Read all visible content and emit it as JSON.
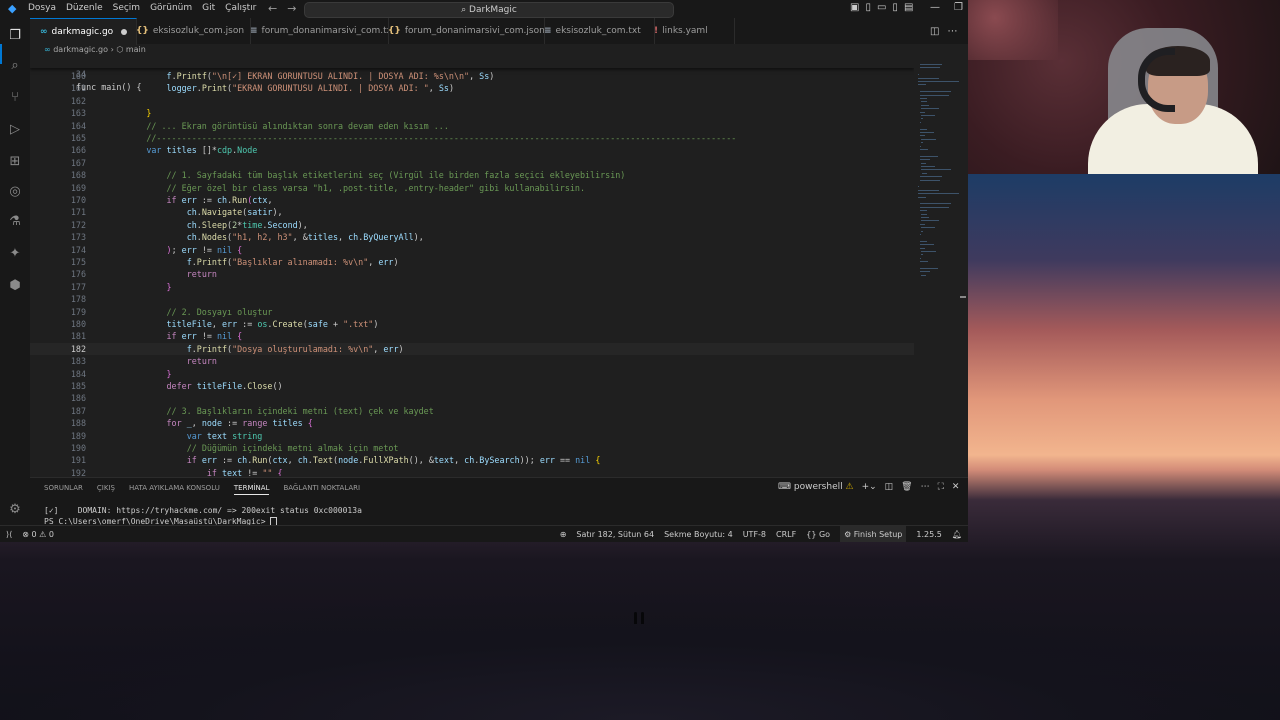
{
  "window": {
    "menu": [
      "Dosya",
      "Düzenle",
      "Seçim",
      "Görünüm",
      "Git",
      "Çalıştır"
    ],
    "search_text": "DarkMagic"
  },
  "tabs": [
    {
      "label": "darkmagic.go",
      "icon": "go-file-icon",
      "active": true,
      "modified": true
    },
    {
      "label": "eksisozluk_com.json",
      "icon": "json-file-icon"
    },
    {
      "label": "forum_donanimarsivi_com.txt",
      "icon": "text-file-icon"
    },
    {
      "label": "forum_donanimarsivi_com.json",
      "icon": "json-file-icon"
    },
    {
      "label": "eksisozluk_com.txt",
      "icon": "text-file-icon"
    },
    {
      "label": "links.yaml",
      "icon": "yaml-file-icon"
    }
  ],
  "breadcrumb": {
    "file": "darkmagic.go",
    "symbol": "main"
  },
  "editor": {
    "sticky_line": {
      "num": "34",
      "text": "func main() {"
    },
    "current_line": "182",
    "lines": [
      {
        "num": "160",
        "html": "            <span class=\"vr\">f</span>.<span class=\"fn\">Printf</span>(<span class=\"str\">\"\\n[✓] EKRAN GORUNTUSU ALINDI. | DOSYA ADI: %s\\n\\n\"</span>, <span class=\"vr\">Ss</span>)"
      },
      {
        "num": "161",
        "html": "            <span class=\"vr\">logger</span>.<span class=\"fn\">Print</span>(<span class=\"str\">\"EKRAN GORUNTUSU ALINDI. | DOSYA ADI: \"</span>, <span class=\"vr\">Ss</span>)"
      },
      {
        "num": "162",
        "html": ""
      },
      {
        "num": "163",
        "html": "        <span class=\"br\">}</span>"
      },
      {
        "num": "164",
        "html": "        <span class=\"cm\">// ... Ekran görüntüsü alındıktan sonra devam eden kısım ...</span>"
      },
      {
        "num": "165",
        "html": "        <span class=\"cm\">//-------------------------------------------------------------------------------------------------------------------</span>"
      },
      {
        "num": "166",
        "html": "        <span class=\"kw\">var</span> <span class=\"vr\">titles</span> []*<span class=\"ty\">cdp</span>.<span class=\"ty\">Node</span>"
      },
      {
        "num": "167",
        "html": ""
      },
      {
        "num": "168",
        "html": "            <span class=\"cm\">// 1. Sayfadaki tüm başlık etiketlerini seç (Virgül ile birden fazla seçici ekleyebilirsin)</span>"
      },
      {
        "num": "169",
        "html": "            <span class=\"cm\">// Eğer özel bir class varsa \"h1, .post-title, .entry-header\" gibi kullanabilirsin.</span>"
      },
      {
        "num": "170",
        "html": "            <span class=\"ctl\">if</span> <span class=\"vr\">err</span> := <span class=\"vr\">ch</span>.<span class=\"fn\">Run</span><span class=\"br2\">(</span><span class=\"vr\">ctx</span>,"
      },
      {
        "num": "171",
        "html": "                <span class=\"vr\">ch</span>.<span class=\"fn\">Navigate</span>(<span class=\"vr\">satir</span>),"
      },
      {
        "num": "172",
        "html": "                <span class=\"vr\">ch</span>.<span class=\"fn\">Sleep</span>(<span class=\"nm\">2</span>*<span class=\"ty\">time</span>.<span class=\"vr\">Second</span>),"
      },
      {
        "num": "173",
        "html": "                <span class=\"vr\">ch</span>.<span class=\"fn\">Nodes</span>(<span class=\"str\">\"h1, h2, h3\"</span>, &amp;<span class=\"vr\">titles</span>, <span class=\"vr\">ch</span>.<span class=\"vr\">ByQueryAll</span>),"
      },
      {
        "num": "174",
        "html": "            <span class=\"br2\">)</span>; <span class=\"vr\">err</span> != <span class=\"kw\">nil</span> <span class=\"br2\">{</span>"
      },
      {
        "num": "175",
        "html": "                <span class=\"vr\">f</span>.<span class=\"fn\">Printf</span>(<span class=\"str\">\"Başlıklar alınamadı: %v\\n\"</span>, <span class=\"vr\">err</span>)"
      },
      {
        "num": "176",
        "html": "                <span class=\"ctl\">return</span>"
      },
      {
        "num": "177",
        "html": "            <span class=\"br2\">}</span>"
      },
      {
        "num": "178",
        "html": ""
      },
      {
        "num": "179",
        "html": "            <span class=\"cm\">// 2. Dosyayı oluştur</span>"
      },
      {
        "num": "180",
        "html": "            <span class=\"vr\">titleFile</span>, <span class=\"vr\">err</span> := <span class=\"ty\">os</span>.<span class=\"fn\">Create</span>(<span class=\"vr\">safe</span> + <span class=\"str\">\".txt\"</span>)"
      },
      {
        "num": "181",
        "html": "            <span class=\"ctl\">if</span> <span class=\"vr\">err</span> != <span class=\"kw\">nil</span> <span class=\"br2\">{</span>"
      },
      {
        "num": "182",
        "html": "                <span class=\"vr\">f</span>.<span class=\"fn\">Printf</span>(<span class=\"str\">\"Dosya oluşturulamadı: %v\\n\"</span>, <span class=\"vr\">err</span>)"
      },
      {
        "num": "183",
        "html": "                <span class=\"ctl\">return</span>"
      },
      {
        "num": "184",
        "html": "            <span class=\"br2\">}</span>"
      },
      {
        "num": "185",
        "html": "            <span class=\"ctl\">defer</span> <span class=\"vr\">titleFile</span>.<span class=\"fn\">Close</span>()"
      },
      {
        "num": "186",
        "html": ""
      },
      {
        "num": "187",
        "html": "            <span class=\"cm\">// 3. Başlıkların içindeki metni (text) çek ve kaydet</span>"
      },
      {
        "num": "188",
        "html": "            <span class=\"ctl\">for</span> <span class=\"vr\">_</span>, <span class=\"vr\">node</span> := <span class=\"ctl\">range</span> <span class=\"vr\">titles</span> <span class=\"br2\">{</span>"
      },
      {
        "num": "189",
        "html": "                <span class=\"kw\">var</span> <span class=\"vr\">text</span> <span class=\"ty\">string</span>"
      },
      {
        "num": "190",
        "html": "                <span class=\"cm\">// Düğümün içindeki metni almak için metot</span>"
      },
      {
        "num": "191",
        "html": "                <span class=\"ctl\">if</span> <span class=\"vr\">err</span> := <span class=\"vr\">ch</span>.<span class=\"fn\">Run</span>(<span class=\"vr\">ctx</span>, <span class=\"vr\">ch</span>.<span class=\"fn\">Text</span>(<span class=\"vr\">node</span>.<span class=\"fn\">FullXPath</span>(), &amp;<span class=\"vr\">text</span>, <span class=\"vr\">ch</span>.<span class=\"vr\">BySearch</span>)); <span class=\"vr\">err</span> == <span class=\"kw\">nil</span> <span class=\"br\">{</span>"
      },
      {
        "num": "192",
        "html": "                    <span class=\"ctl\">if</span> <span class=\"vr\">text</span> != <span class=\"str\">\"\"</span> <span class=\"br2\">{</span>"
      }
    ]
  },
  "panel": {
    "tabs": [
      "SORUNLAR",
      "ÇIKIŞ",
      "HATA AYIKLAMA KONSOLU",
      "TERMİNAL",
      "BAĞLANTI NOKTALARI"
    ],
    "active_tab": "TERMİNAL",
    "shell_label": "powershell",
    "terminal_lines": [
      "[✓]    DOMAIN: https://tryhackme.com/ => 200exit status 0xc000013a",
      "PS C:\\Users\\omerf\\OneDrive\\Masaüstü\\DarkMagic> "
    ]
  },
  "statusbar": {
    "errors": "0",
    "warnings": "0",
    "position": "Satır 182, Sütun 64",
    "indent": "Sekme Boyutu: 4",
    "encoding": "UTF-8",
    "eol": "CRLF",
    "language": "Go",
    "setup": "Finish Setup",
    "version": "1.25.5"
  },
  "colors": {
    "accent": "#0078d4",
    "editor_bg": "#1f1f1f",
    "chrome_bg": "#181818"
  }
}
